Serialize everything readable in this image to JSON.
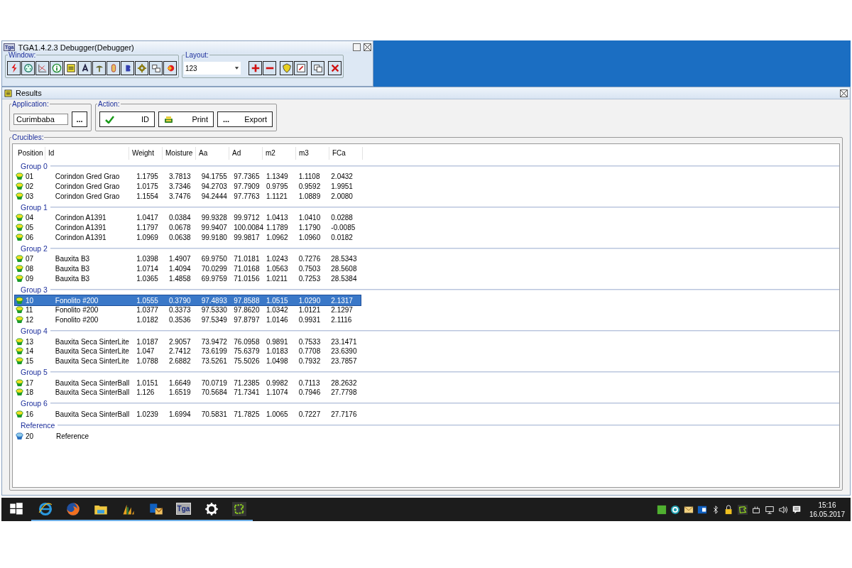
{
  "debugger_window": {
    "title": "TGA1.4.2.3 Debugger(Debugger)",
    "app_badge": "Tga",
    "window_group": {
      "label": "Window:",
      "buttons": [
        {
          "selected": false
        },
        {
          "selected": false
        },
        {
          "selected": false
        },
        {
          "selected": false
        },
        {
          "selected": true
        },
        {
          "selected": false
        },
        {
          "selected": false
        },
        {
          "selected": false
        },
        {
          "selected": false
        },
        {
          "selected": false
        },
        {
          "selected": false
        },
        {
          "selected": false
        }
      ]
    },
    "layout_group": {
      "label": "Layout:",
      "value": "123"
    }
  },
  "results_window": {
    "title": "Results",
    "application": {
      "label": "Application:",
      "value": "Curimbaba",
      "browse": "..."
    },
    "action": {
      "label": "Action:",
      "buttons": [
        {
          "kind": "check",
          "label": "ID"
        },
        {
          "kind": "printer",
          "label": "Print"
        },
        {
          "kind": "dots",
          "icon_text": "...",
          "label": "Export"
        }
      ]
    },
    "crucibles": {
      "label": "Crucibles:",
      "columns": [
        "Position",
        "Id",
        "Weight",
        "Moisture",
        "Aa",
        "Ad",
        "m2",
        "m3",
        "FCa"
      ],
      "groups": [
        {
          "name": "Group 0",
          "rows": [
            {
              "kind": "sample",
              "selected": false,
              "cells": [
                "01",
                "Corindon Gred Grao",
                "1.1795",
                "3.7813",
                "94.1755",
                "97.7365",
                "1.1349",
                "1.1108",
                "2.0432"
              ]
            },
            {
              "kind": "sample",
              "selected": false,
              "cells": [
                "02",
                "Corindon Gred Grao",
                "1.0175",
                "3.7346",
                "94.2703",
                "97.7909",
                "0.9795",
                "0.9592",
                "1.9951"
              ]
            },
            {
              "kind": "sample",
              "selected": false,
              "cells": [
                "03",
                "Corindon Gred Grao",
                "1.1554",
                "3.7476",
                "94.2444",
                "97.7763",
                "1.1121",
                "1.0889",
                "2.0080"
              ]
            }
          ]
        },
        {
          "name": "Group 1",
          "rows": [
            {
              "kind": "sample",
              "selected": false,
              "cells": [
                "04",
                "Corindon A1391",
                "1.0417",
                "0.0384",
                "99.9328",
                "99.9712",
                "1.0413",
                "1.0410",
                "0.0288"
              ]
            },
            {
              "kind": "sample",
              "selected": false,
              "cells": [
                "05",
                "Corindon A1391",
                "1.1797",
                "0.0678",
                "99.9407",
                "100.0084",
                "1.1789",
                "1.1790",
                "-0.0085"
              ]
            },
            {
              "kind": "sample",
              "selected": false,
              "cells": [
                "06",
                "Corindon A1391",
                "1.0969",
                "0.0638",
                "99.9180",
                "99.9817",
                "1.0962",
                "1.0960",
                "0.0182"
              ]
            }
          ]
        },
        {
          "name": "Group 2",
          "rows": [
            {
              "kind": "sample",
              "selected": false,
              "cells": [
                "07",
                "Bauxita B3",
                "1.0398",
                "1.4907",
                "69.9750",
                "71.0181",
                "1.0243",
                "0.7276",
                "28.5343"
              ]
            },
            {
              "kind": "sample",
              "selected": false,
              "cells": [
                "08",
                "Bauxita B3",
                "1.0714",
                "1.4094",
                "70.0299",
                "71.0168",
                "1.0563",
                "0.7503",
                "28.5608"
              ]
            },
            {
              "kind": "sample",
              "selected": false,
              "cells": [
                "09",
                "Bauxita B3",
                "1.0365",
                "1.4858",
                "69.9759",
                "71.0156",
                "1.0211",
                "0.7253",
                "28.5384"
              ]
            }
          ]
        },
        {
          "name": "Group 3",
          "rows": [
            {
              "kind": "sample",
              "selected": true,
              "cells": [
                "10",
                "Fonolito #200",
                "1.0555",
                "0.3790",
                "97.4893",
                "97.8588",
                "1.0515",
                "1.0290",
                "2.1317"
              ]
            },
            {
              "kind": "sample",
              "selected": false,
              "cells": [
                "11",
                "Fonolito #200",
                "1.0377",
                "0.3373",
                "97.5330",
                "97.8620",
                "1.0342",
                "1.0121",
                "2.1297"
              ]
            },
            {
              "kind": "sample",
              "selected": false,
              "cells": [
                "12",
                "Fonolito #200",
                "1.0182",
                "0.3536",
                "97.5349",
                "97.8797",
                "1.0146",
                "0.9931",
                "2.1116"
              ]
            }
          ]
        },
        {
          "name": "Group 4",
          "rows": [
            {
              "kind": "sample",
              "selected": false,
              "cells": [
                "13",
                "Bauxita Seca SinterLite",
                "1.0187",
                "2.9057",
                "73.9472",
                "76.0958",
                "0.9891",
                "0.7533",
                "23.1471"
              ]
            },
            {
              "kind": "sample",
              "selected": false,
              "cells": [
                "14",
                "Bauxita Seca SinterLite",
                "1.047",
                "2.7412",
                "73.6199",
                "75.6379",
                "1.0183",
                "0.7708",
                "23.6390"
              ]
            },
            {
              "kind": "sample",
              "selected": false,
              "cells": [
                "15",
                "Bauxita Seca SinterLite",
                "1.0788",
                "2.6882",
                "73.5261",
                "75.5026",
                "1.0498",
                "0.7932",
                "23.7857"
              ]
            }
          ]
        },
        {
          "name": "Group 5",
          "rows": [
            {
              "kind": "sample",
              "selected": false,
              "cells": [
                "17",
                "Bauxita Seca SinterBall",
                "1.0151",
                "1.6649",
                "70.0719",
                "71.2385",
                "0.9982",
                "0.7113",
                "28.2632"
              ]
            },
            {
              "kind": "sample",
              "selected": false,
              "cells": [
                "18",
                "Bauxita Seca SinterBall",
                "1.126",
                "1.6519",
                "70.5684",
                "71.7341",
                "1.1074",
                "0.7946",
                "27.7798"
              ]
            }
          ]
        },
        {
          "name": "Group 6",
          "rows": [
            {
              "kind": "sample",
              "selected": false,
              "cells": [
                "16",
                "Bauxita Seca SinterBall",
                "1.0239",
                "1.6994",
                "70.5831",
                "71.7825",
                "1.0065",
                "0.7227",
                "27.7176"
              ]
            }
          ]
        },
        {
          "name": "Reference",
          "rows": [
            {
              "kind": "reference",
              "selected": false,
              "cells": [
                "20",
                "Reference"
              ]
            }
          ]
        }
      ]
    }
  },
  "taskbar": {
    "apps": [
      {
        "running": true
      },
      {
        "running": true
      },
      {
        "running": true
      },
      {
        "running": true
      },
      {
        "running": true
      },
      {
        "running": true,
        "label": "Tga"
      },
      {
        "running": true
      },
      {
        "running": true
      }
    ],
    "time": "15:16",
    "date": "16.05.2017"
  }
}
